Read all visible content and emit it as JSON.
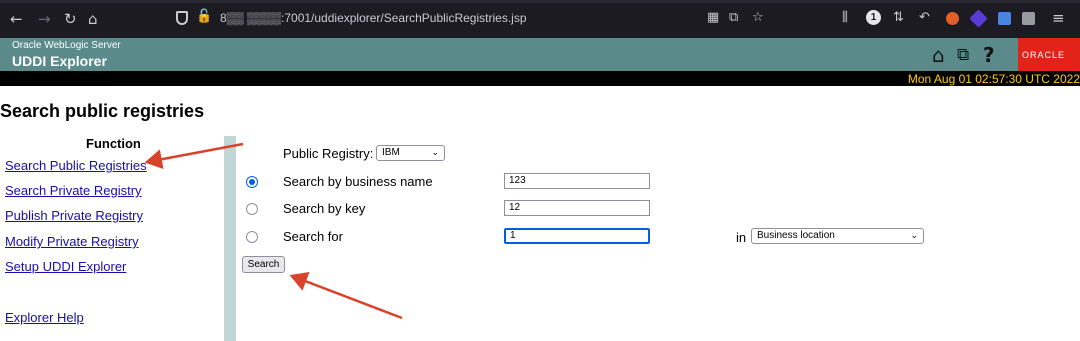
{
  "browser": {
    "url": "8▒▒ ▒▒▒▒:7001/uddiexplorer/SearchPublicRegistries.jsp",
    "badge_count": "1"
  },
  "header": {
    "product": "Oracle WebLogic Server",
    "title": "UDDI Explorer",
    "logo": "ORACLE",
    "datetime": "Mon Aug 01 02:57:30 UTC 2022"
  },
  "page": {
    "title": "Search public registries"
  },
  "sidebar": {
    "heading": "Function",
    "links": [
      "Search Public Registries",
      "Search Private Registry",
      "Publish Private Registry",
      "Modify Private Registry",
      "Setup UDDI Explorer"
    ],
    "help": "Explorer Help"
  },
  "form": {
    "registry_label": "Public Registry:",
    "registry_value": "IBM",
    "options": [
      {
        "label": "Search by business name",
        "value": "123",
        "checked": true
      },
      {
        "label": "Search by key",
        "value": "12",
        "checked": false
      },
      {
        "label": "Search for",
        "value": "1",
        "checked": false
      }
    ],
    "in_label": "in",
    "location_value": "Business location",
    "submit_label": "Search"
  },
  "colors": {
    "header_bg": "#5a8a8a",
    "accent": "#0060df",
    "link": "#1a0dab",
    "annotation": "#d9432b",
    "date_text": "#ffcc00"
  }
}
